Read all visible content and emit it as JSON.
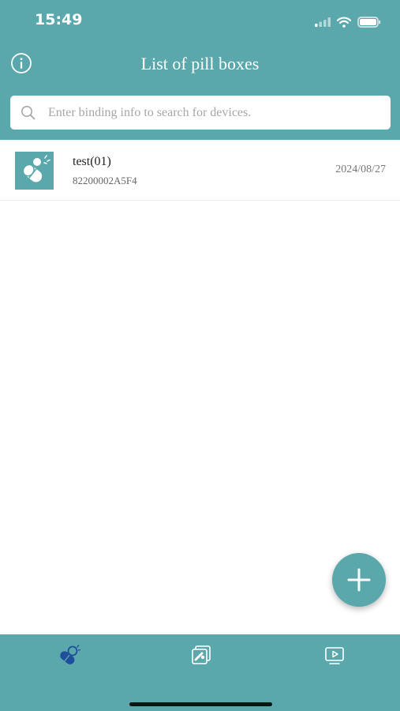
{
  "status_bar": {
    "time": "15:49"
  },
  "header": {
    "title": "List of pill boxes",
    "info_icon": "info-icon"
  },
  "search": {
    "placeholder": "Enter binding info to search for devices.",
    "value": ""
  },
  "devices": [
    {
      "name": "test(01)",
      "id": "82200002A5F4",
      "date": "2024/08/27",
      "icon": "pill-icon"
    }
  ],
  "fab": {
    "icon": "plus-icon"
  },
  "tabs": [
    {
      "icon": "pill-box-icon",
      "active": true
    },
    {
      "icon": "medication-record-icon",
      "active": false
    },
    {
      "icon": "video-icon",
      "active": false
    }
  ],
  "colors": {
    "primary": "#5aa8ab",
    "active_tab": "#1f4e9c",
    "text": "#222222",
    "muted": "#777777"
  }
}
